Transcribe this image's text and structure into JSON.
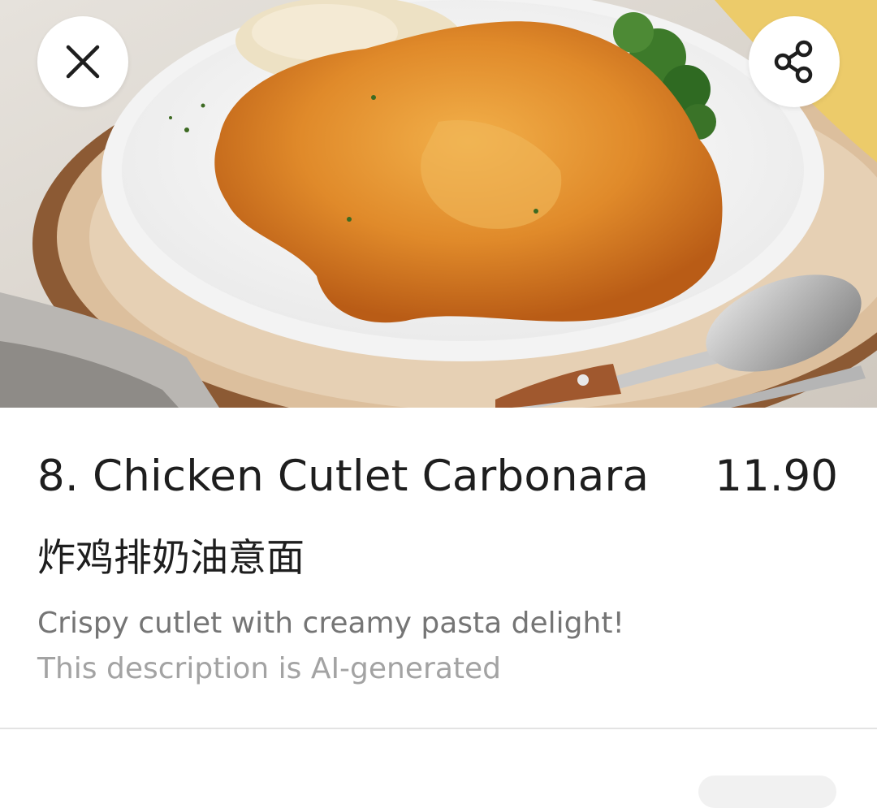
{
  "header": {
    "image_alt": "Chicken cutlet with carbonara pasta on a white plate",
    "close_icon": "close-icon",
    "share_icon": "share-icon"
  },
  "item": {
    "title": "8. Chicken Cutlet Carbonara",
    "price": "11.90",
    "name_zh": "炸鸡排奶油意面",
    "description": "Crispy cutlet with creamy pasta delight!",
    "ai_note": "This description is AI-generated"
  },
  "colors": {
    "title_text": "#1e1e1e",
    "description_text": "#757575",
    "note_text": "#a3a3a3",
    "divider": "#e3e3e3"
  }
}
